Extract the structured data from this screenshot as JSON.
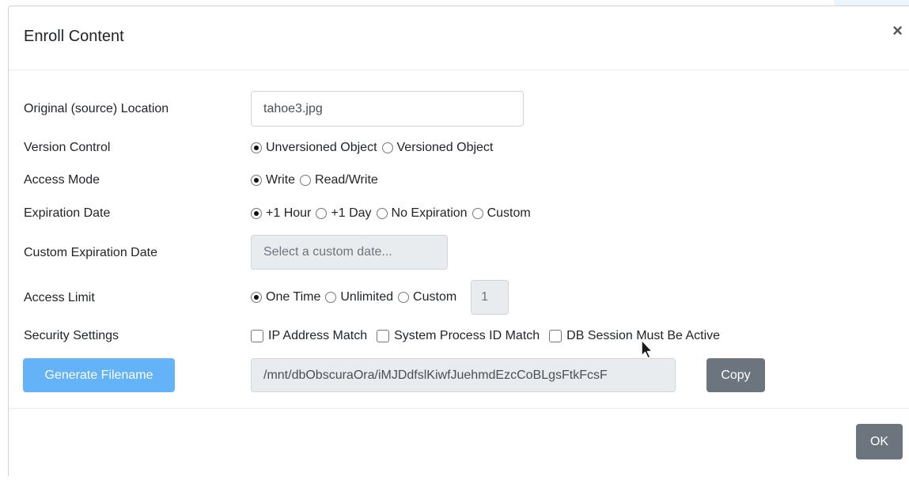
{
  "modal": {
    "title": "Enroll Content",
    "close_glyph": "×"
  },
  "form": {
    "source_location": {
      "label": "Original (source) Location",
      "value": "tahoe3.jpg"
    },
    "version_control": {
      "label": "Version Control",
      "options": [
        {
          "label": "Unversioned Object",
          "checked": true
        },
        {
          "label": "Versioned Object",
          "checked": false
        }
      ]
    },
    "access_mode": {
      "label": "Access Mode",
      "options": [
        {
          "label": "Write",
          "checked": true
        },
        {
          "label": "Read/Write",
          "checked": false
        }
      ]
    },
    "expiration_date": {
      "label": "Expiration Date",
      "options": [
        {
          "label": "+1 Hour",
          "checked": true
        },
        {
          "label": "+1 Day",
          "checked": false
        },
        {
          "label": "No Expiration",
          "checked": false
        },
        {
          "label": "Custom",
          "checked": false
        }
      ]
    },
    "custom_expiration": {
      "label": "Custom Expiration Date",
      "placeholder": "Select a custom date..."
    },
    "access_limit": {
      "label": "Access Limit",
      "options": [
        {
          "label": "One Time",
          "checked": true
        },
        {
          "label": "Unlimited",
          "checked": false
        },
        {
          "label": "Custom",
          "checked": false
        }
      ],
      "custom_value": "1"
    },
    "security_settings": {
      "label": "Security Settings",
      "options": [
        {
          "label": "IP Address Match",
          "checked": false
        },
        {
          "label": "System Process ID Match",
          "checked": false
        },
        {
          "label": "DB Session Must Be Active",
          "checked": false
        }
      ]
    },
    "generate_button": "Generate Filename",
    "generated_filename": "/mnt/dbObscuraOra/iMJDdfslKiwfJuehmdEzcCoBLgsFtkFcsF",
    "copy_button": "Copy"
  },
  "footer": {
    "ok_button": "OK"
  },
  "colors": {
    "primary": "#64b2f8",
    "secondary": "#6c757d"
  },
  "icons": {
    "cursor": "mouse-pointer-icon"
  }
}
